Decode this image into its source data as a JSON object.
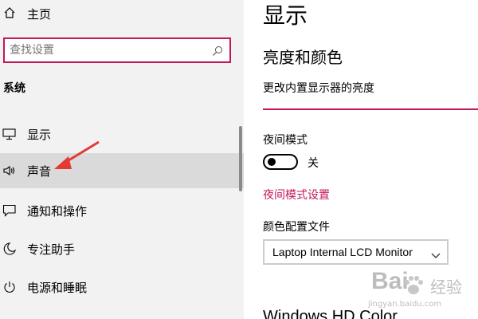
{
  "sidebar": {
    "home_label": "主页",
    "search": {
      "placeholder": "查找设置"
    },
    "group_title": "系统",
    "items": [
      {
        "label": "显示",
        "icon": "monitor-icon"
      },
      {
        "label": "声音",
        "icon": "speaker-icon",
        "selected": true
      },
      {
        "label": "通知和操作",
        "icon": "message-icon"
      },
      {
        "label": "专注助手",
        "icon": "moon-icon"
      },
      {
        "label": "电源和睡眠",
        "icon": "power-icon"
      }
    ]
  },
  "main": {
    "page_title": "显示",
    "section_title": "亮度和颜色",
    "brightness_label": "更改内置显示器的亮度",
    "night_light": {
      "label": "夜间模式",
      "state_label": "关",
      "on": false
    },
    "night_settings_link": "夜间模式设置",
    "color_profile": {
      "label": "颜色配置文件",
      "selected": "Laptop Internal LCD Monitor"
    },
    "hd_color_title": "Windows HD Color"
  },
  "watermark": {
    "brand_left": "Bai",
    "brand_right": "经验",
    "url": "jingyan.baidu.com"
  },
  "colors": {
    "accent": "#c2185b",
    "sidebar_bg": "#f2f2f2",
    "selected_bg": "#dadada",
    "annotation_arrow": "#e53935"
  }
}
